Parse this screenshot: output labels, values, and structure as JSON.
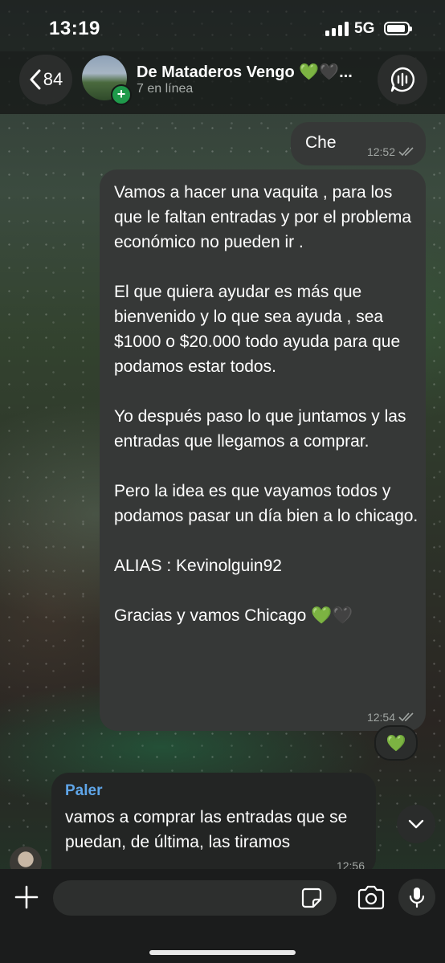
{
  "status_bar": {
    "time": "13:19",
    "network": "5G"
  },
  "header": {
    "back_count": "84",
    "group_name": "De Mataderos Vengo 💚🖤...",
    "group_status": "7 en línea"
  },
  "messages": [
    {
      "direction": "outgoing",
      "text": "Che",
      "time": "12:52",
      "read": true
    },
    {
      "direction": "outgoing",
      "text": "Vamos a hacer una vaquita , para los que le faltan entradas y por el problema económico no pueden ir .\n\nEl que quiera ayudar es más que bienvenido y lo que sea ayuda , sea $1000 o $20.000 todo ayuda para que podamos estar todos.\n\nYo después paso lo que juntamos y las entradas que llegamos a comprar.\n\nPero la idea es que vayamos todos y podamos pasar un día bien a lo chicago.\n\nALIAS : Kevinolguin92\n\nGracias y vamos Chicago 💚🖤",
      "time": "12:54",
      "read": true,
      "reaction": "💚"
    },
    {
      "direction": "incoming",
      "sender": "Paler",
      "text": "vamos a comprar las entradas que se puedan, de última, las tiramos",
      "time": "12:56"
    }
  ],
  "input": {
    "placeholder": ""
  },
  "colors": {
    "sender_name": "#5fa5e8",
    "outgoing_bubble": "#363837",
    "incoming_bubble": "#232524",
    "add_member_badge": "#1f9a4b"
  },
  "icons": [
    "signal-icon",
    "battery-icon",
    "back-chevron-icon",
    "voice-chat-icon",
    "chevron-down-icon",
    "plus-icon",
    "sticker-icon",
    "camera-icon",
    "microphone-icon"
  ]
}
